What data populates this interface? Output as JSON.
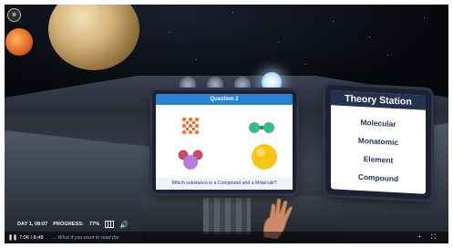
{
  "quiz": {
    "header": "Question 2",
    "question": "Which substance is a Compound and a Molecule?",
    "options": [
      {
        "icon": "grid-lattice-icon",
        "color": "#f07a3a"
      },
      {
        "icon": "diatomic-molecule-icon",
        "color": "#3db88e"
      },
      {
        "icon": "triatomic-molecule-icon",
        "color": "#c24f6a"
      },
      {
        "icon": "single-atom-icon",
        "color": "#f5c518"
      }
    ]
  },
  "theory": {
    "title": "Theory Station",
    "items": [
      "Molecular",
      "Monatomic",
      "Element",
      "Compound"
    ]
  },
  "hud": {
    "day": "DAY 1, 08:07",
    "progress_label": "PROGRESS:",
    "progress_value": "77%"
  },
  "player": {
    "time": "7:06 / 8:48",
    "caption": "... What if you want to read the"
  },
  "colors": {
    "accent": "#2b7fd6",
    "theory_header": "#23324f",
    "panel_frame": "#2e3546"
  }
}
